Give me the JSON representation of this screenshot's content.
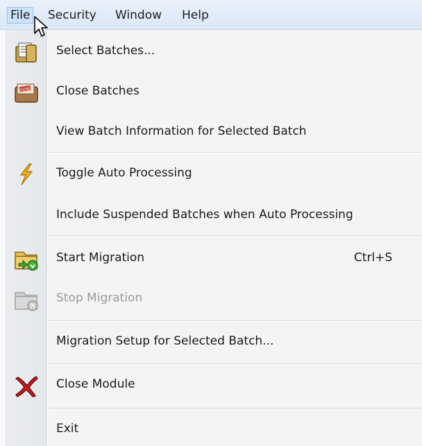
{
  "menubar": {
    "file": "File",
    "security": "Security",
    "window": "Window",
    "help": "Help"
  },
  "file_menu": {
    "select_batches": "Select Batches...",
    "close_batches": "Close Batches",
    "view_batch_info": "View Batch Information for Selected Batch",
    "toggle_auto": "Toggle Auto Processing",
    "include_suspended": "Include Suspended Batches when Auto Processing",
    "start_migration": "Start Migration",
    "start_migration_shortcut": "Ctrl+S",
    "stop_migration": "Stop Migration",
    "migration_setup": "Migration Setup for Selected Batch...",
    "close_module": "Close Module",
    "exit": "Exit"
  },
  "icons": {
    "select_batches": "select-batches-icon",
    "close_batches": "close-batches-icon",
    "toggle_auto": "lightning-icon",
    "start_migration": "start-migration-icon",
    "stop_migration": "stop-migration-icon",
    "close_module": "close-x-icon"
  }
}
